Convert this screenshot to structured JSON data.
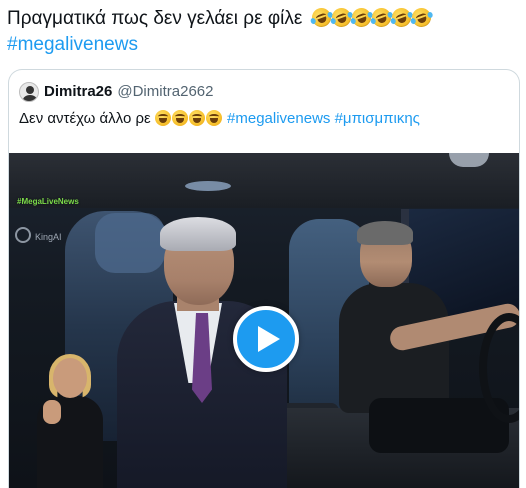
{
  "tweet": {
    "text": "Πραγματικά πως δεν γελάει ρε φίλε",
    "emoji_count": 6,
    "emoji_icon": "rolling-on-floor-laughing-icon",
    "hashtag": "#megalivenews"
  },
  "quote": {
    "display_name": "Dimitra26",
    "handle": "@Dimitra2662",
    "text_before": "Δεν αντέχω άλλο ρε",
    "emoji_count": 4,
    "emoji_icon": "face-with-tears-of-joy-icon",
    "hashtags": "#megalivenews #μπισμπικης"
  },
  "video": {
    "watermark": "#MegaLiveNews",
    "watermark_sub": "KingAI",
    "play_icon": "play-icon"
  },
  "colors": {
    "link": "#1d9bf0",
    "text": "#0f1419",
    "muted": "#536471",
    "border": "#cfd9de"
  }
}
